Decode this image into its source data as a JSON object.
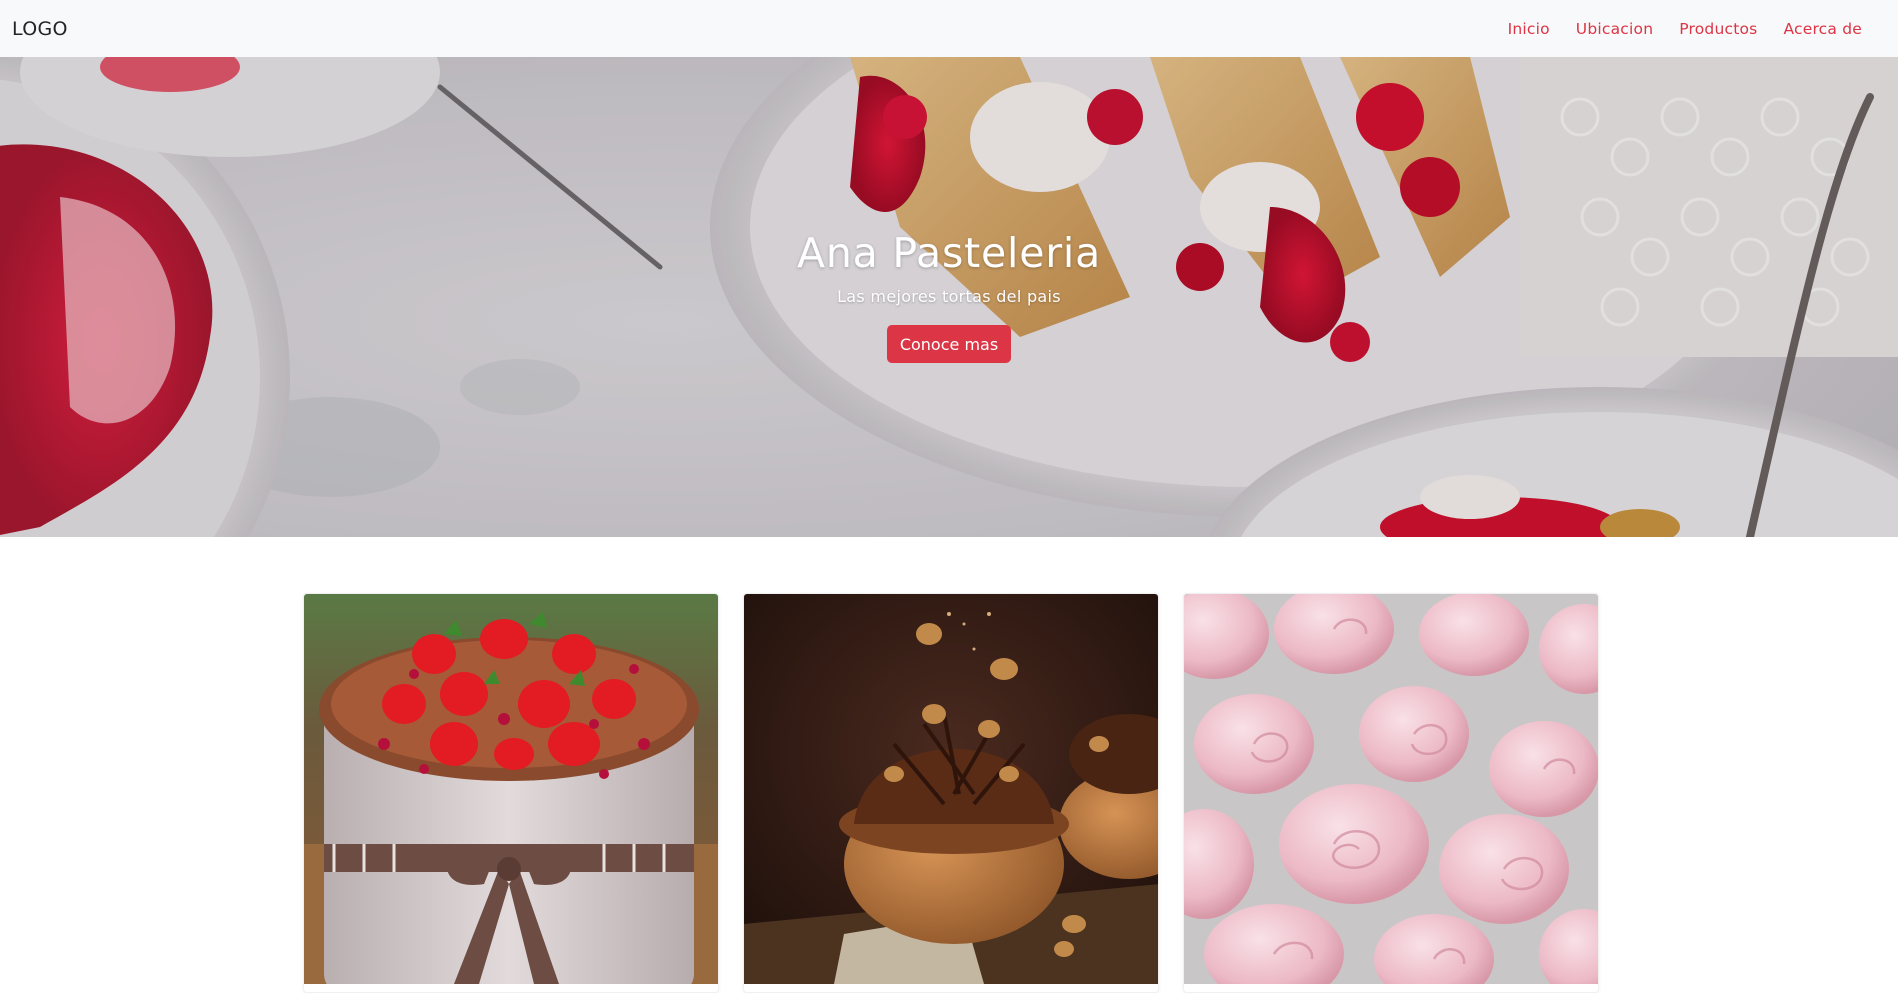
{
  "navbar": {
    "logo": "LOGO",
    "links": [
      {
        "label": "Inicio"
      },
      {
        "label": "Ubicacion"
      },
      {
        "label": "Productos"
      },
      {
        "label": "Acerca de"
      }
    ],
    "link_color": "#dc3545"
  },
  "hero": {
    "title": "Ana Pasteleria",
    "subtitle": "Las mejores tortas del pais",
    "button_label": "Conoce mas",
    "button_color": "#dc3545",
    "image": "berry-cake-slices-on-white-plates-photo"
  },
  "products": [
    {
      "image": "strawberry-pomegranate-fig-cake-photo"
    },
    {
      "image": "chocolate-hazelnut-cream-puff-photo"
    },
    {
      "image": "pink-meringue-roses-photo"
    }
  ]
}
